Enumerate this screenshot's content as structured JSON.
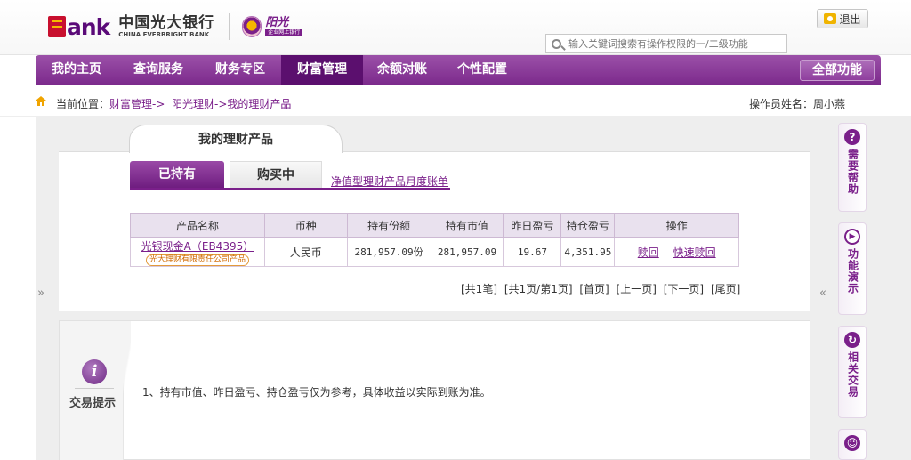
{
  "brand": {
    "logo_en_mark": "B",
    "logo_en": "ank",
    "logo_cn": "中国光大银行",
    "logo_cn_sub": "CHINA EVERBRIGHT BANK",
    "badge_title": "阳光",
    "badge_sub": "企业网上银行"
  },
  "header": {
    "logout_label": "退出",
    "search_placeholder": "输入关键词搜索有操作权限的一/二级功能"
  },
  "nav": {
    "items": [
      {
        "label": "我的主页",
        "active": false
      },
      {
        "label": "查询服务",
        "active": false
      },
      {
        "label": "财务专区",
        "active": false
      },
      {
        "label": "财富管理",
        "active": true
      },
      {
        "label": "余额对账",
        "active": false
      },
      {
        "label": "个性配置",
        "active": false
      }
    ],
    "all_functions": "全部功能"
  },
  "breadcrumb": {
    "prefix": "当前位置：",
    "items": [
      "财富管理->",
      "阳光理财->我的理财产品"
    ]
  },
  "operator": {
    "label": "操作员姓名：",
    "name": "周小燕"
  },
  "panel": {
    "title": "我的理财产品",
    "tabs": [
      {
        "label": "已持有",
        "active": true
      },
      {
        "label": "购买中",
        "active": false
      }
    ],
    "monthly_link": "净值型理财产品月度账单"
  },
  "table": {
    "headers": [
      "产品名称",
      "币种",
      "持有份额",
      "持有市值",
      "昨日盈亏",
      "持仓盈亏",
      "操作"
    ],
    "rows": [
      {
        "product_name": "光银现金A（EB4395）",
        "product_issuer": "光大理财有限责任公司产品",
        "currency": "人民币",
        "shares": "281,957.09份",
        "market_value": "281,957.09",
        "yesterday_pnl": "19.67",
        "position_pnl": "4,351.95",
        "actions": [
          "赎回",
          "快速赎回"
        ]
      }
    ]
  },
  "pagination": {
    "total": "[共1笔]",
    "page_info": "[共1页/第1页]",
    "first": "[首页]",
    "prev": "[上一页]",
    "next": "[下一页]",
    "last": "[尾页]"
  },
  "tips": {
    "title": "交易提示",
    "text": "1、持有市值、昨日盈亏、持仓盈亏仅为参考，具体收益以实际到账为准。"
  },
  "side_rail": [
    {
      "label": "需要帮助",
      "icon": "help-icon"
    },
    {
      "label": "功能演示",
      "icon": "play-icon"
    },
    {
      "label": "相关交易",
      "icon": "refresh-icon"
    },
    {
      "label": "",
      "icon": "smile-icon"
    }
  ],
  "toggles": {
    "left": "»",
    "right": "«"
  },
  "colors": {
    "brand_purple": "#7a1f8a",
    "nav_active": "#5b0f6e",
    "brand_red": "#c8102e",
    "brand_gold": "#f5b800"
  }
}
